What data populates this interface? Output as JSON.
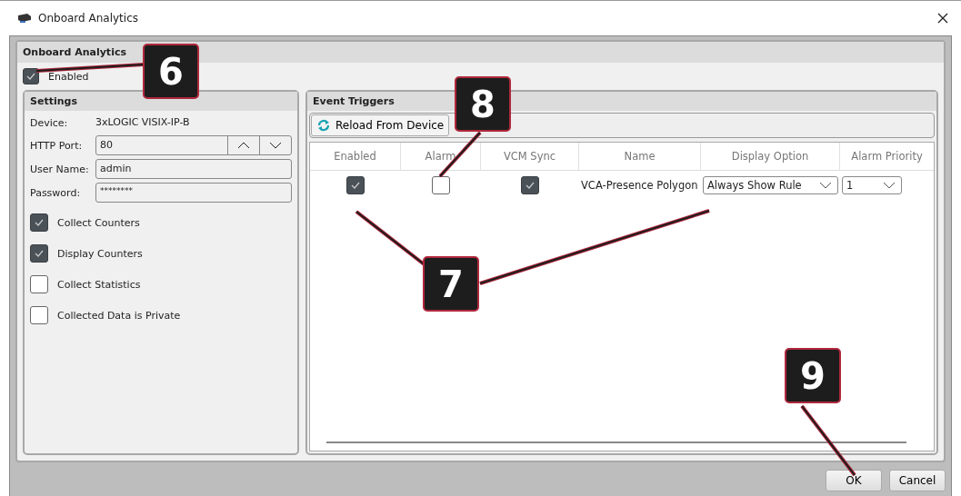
{
  "window": {
    "title": "Onboard Analytics"
  },
  "group": {
    "title": "Onboard Analytics",
    "enabled": {
      "label": "Enabled",
      "checked": true
    }
  },
  "settings": {
    "title": "Settings",
    "device": {
      "label": "Device:",
      "value": "3xLOGIC VISIX-IP-B"
    },
    "http_port": {
      "label": "HTTP Port:",
      "value": "80"
    },
    "user_name": {
      "label": "User Name:",
      "value": "admin"
    },
    "password": {
      "label": "Password:",
      "value": "********"
    },
    "options": [
      {
        "label": "Collect Counters",
        "checked": true
      },
      {
        "label": "Display Counters",
        "checked": true
      },
      {
        "label": "Collect Statistics",
        "checked": false
      },
      {
        "label": "Collected Data is Private",
        "checked": false
      }
    ]
  },
  "event_triggers": {
    "title": "Event Triggers",
    "reload_button": "Reload From Device",
    "columns": [
      "Enabled",
      "Alarm",
      "VCM Sync",
      "Name",
      "Display Option",
      "Alarm Priority"
    ],
    "rows": [
      {
        "enabled": true,
        "alarm": false,
        "vcm_sync": true,
        "name": "VCA-Presence Polygon",
        "display_option": "Always Show Rule",
        "alarm_priority": "1"
      }
    ]
  },
  "buttons": [
    "OK",
    "Cancel"
  ],
  "callouts": [
    {
      "label": "6"
    },
    {
      "label": "8"
    },
    {
      "label": "7"
    },
    {
      "label": "9"
    }
  ]
}
